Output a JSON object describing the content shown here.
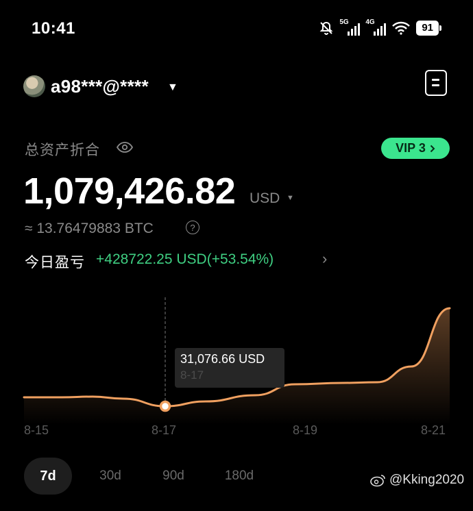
{
  "status_bar": {
    "time": "10:41",
    "signal_1_label": "5G",
    "signal_2_label": "4G",
    "battery": "91"
  },
  "account": {
    "name": "a98***@****"
  },
  "balance": {
    "label": "总资产折合",
    "vip": "VIP 3",
    "amount": "1,079,426.82",
    "currency": "USD",
    "btc": "≈ 13.76479883 BTC",
    "help": "?",
    "pnl_label": "今日盈亏",
    "pnl_value": "+428722.25 USD(+53.54%)"
  },
  "colors": {
    "accent_green": "#3be58e",
    "profit_green": "#3fcf82",
    "line_orange": "#f0a060"
  },
  "chart_data": {
    "type": "area",
    "x": [
      "8-15",
      "8-16",
      "8-17",
      "8-18",
      "8-19",
      "8-20",
      "8-21"
    ],
    "y": [
      5400,
      5900,
      31076.66,
      180000,
      330000,
      350000,
      1079426.82
    ],
    "tick_labels": [
      "8-15",
      "8-17",
      "8-19",
      "8-21"
    ],
    "tooltip": {
      "value": "31,076.66 USD",
      "date": "8-17"
    },
    "unit": "USD"
  },
  "range_tabs": [
    "7d",
    "30d",
    "90d",
    "180d"
  ],
  "watermark": "@Kking2020"
}
